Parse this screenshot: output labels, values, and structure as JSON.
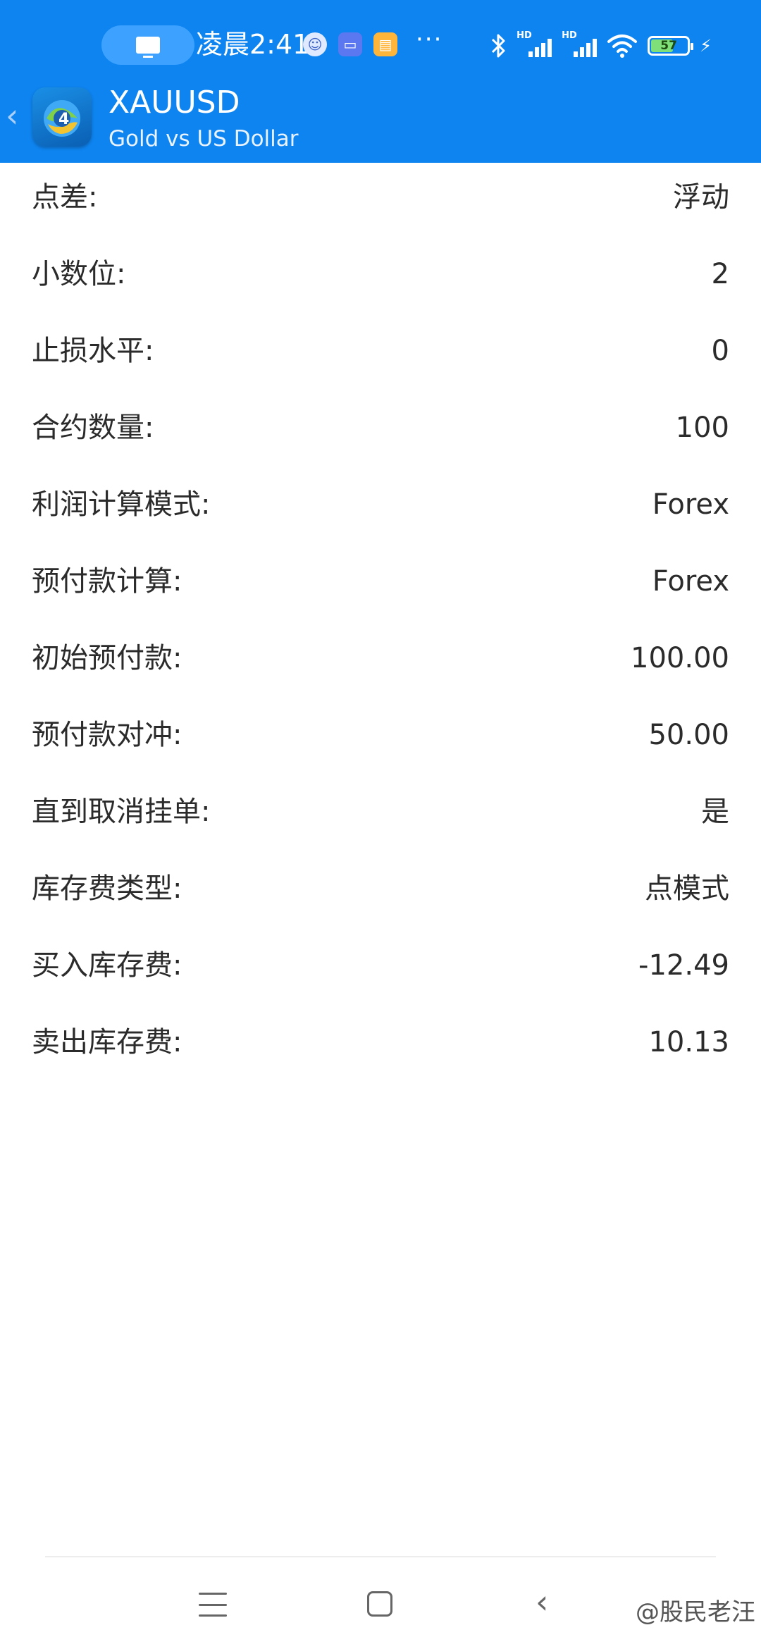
{
  "status_bar": {
    "time": "凌晨2:41",
    "more": "···",
    "battery_percent": "57",
    "hd_label": "HD",
    "bolt": "⚡"
  },
  "header": {
    "back_glyph": "‹",
    "title": "XAUUSD",
    "subtitle": "Gold vs US Dollar",
    "background_color": "#0e84f0"
  },
  "specs": [
    {
      "label": "点差:",
      "value": "浮动"
    },
    {
      "label": "小数位:",
      "value": "2"
    },
    {
      "label": "止损水平:",
      "value": "0"
    },
    {
      "label": "合约数量:",
      "value": "100"
    },
    {
      "label": "利润计算模式:",
      "value": "Forex"
    },
    {
      "label": "预付款计算:",
      "value": "Forex"
    },
    {
      "label": "初始预付款:",
      "value": "100.00"
    },
    {
      "label": "预付款对冲:",
      "value": "50.00"
    },
    {
      "label": "直到取消挂单:",
      "value": "是"
    },
    {
      "label": "库存费类型:",
      "value": "点模式"
    },
    {
      "label": "买入库存费:",
      "value": "-12.49"
    },
    {
      "label": "卖出库存费:",
      "value": "10.13"
    }
  ],
  "nav": {
    "back_glyph": "‹",
    "watermark": "@股民老汪"
  },
  "icons": {
    "cast": "cast-icon",
    "bluetooth": "bluetooth-icon",
    "wifi": "wifi-icon",
    "signal": "signal-icon",
    "battery": "battery-icon",
    "app_logo": "metatrader-logo-icon"
  }
}
